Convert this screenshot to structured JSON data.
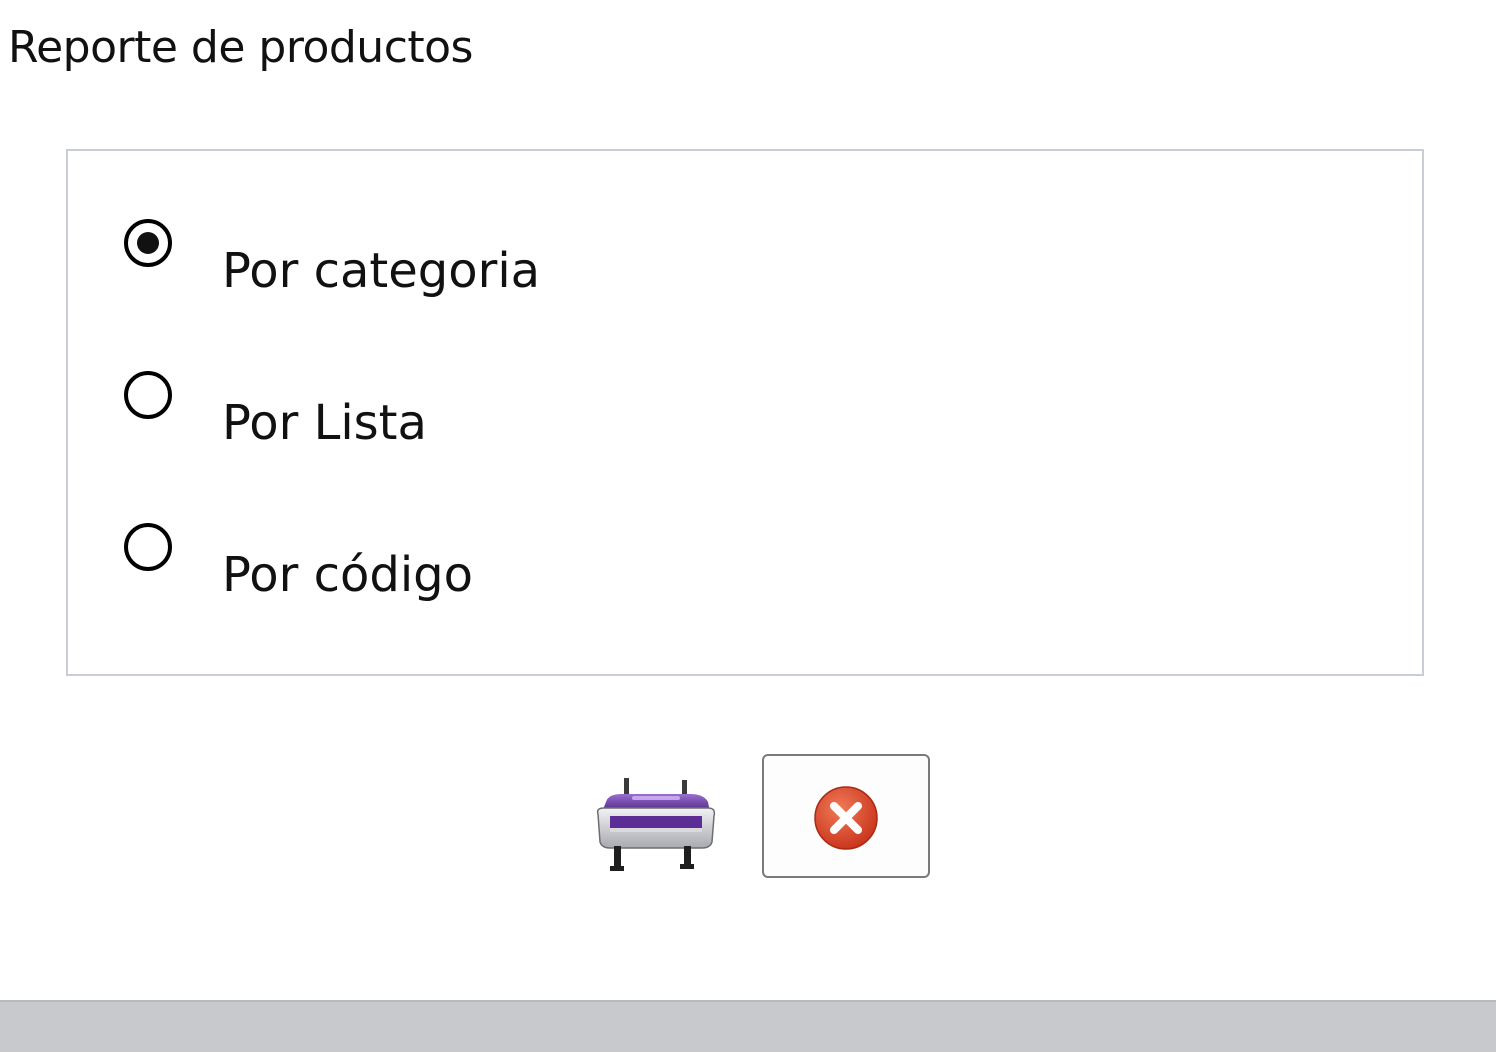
{
  "window": {
    "title": "Reporte de productos"
  },
  "report_options": {
    "selected": "Por categoria",
    "items": [
      {
        "label": "Por categoria",
        "checked": true
      },
      {
        "label": "Por Lista",
        "checked": false
      },
      {
        "label": "Por código",
        "checked": false
      }
    ]
  },
  "actions": {
    "print_icon": "printer-icon",
    "close_icon": "close-circle-icon",
    "print_color": "#6a3fa0",
    "close_color": "#e0452a"
  }
}
